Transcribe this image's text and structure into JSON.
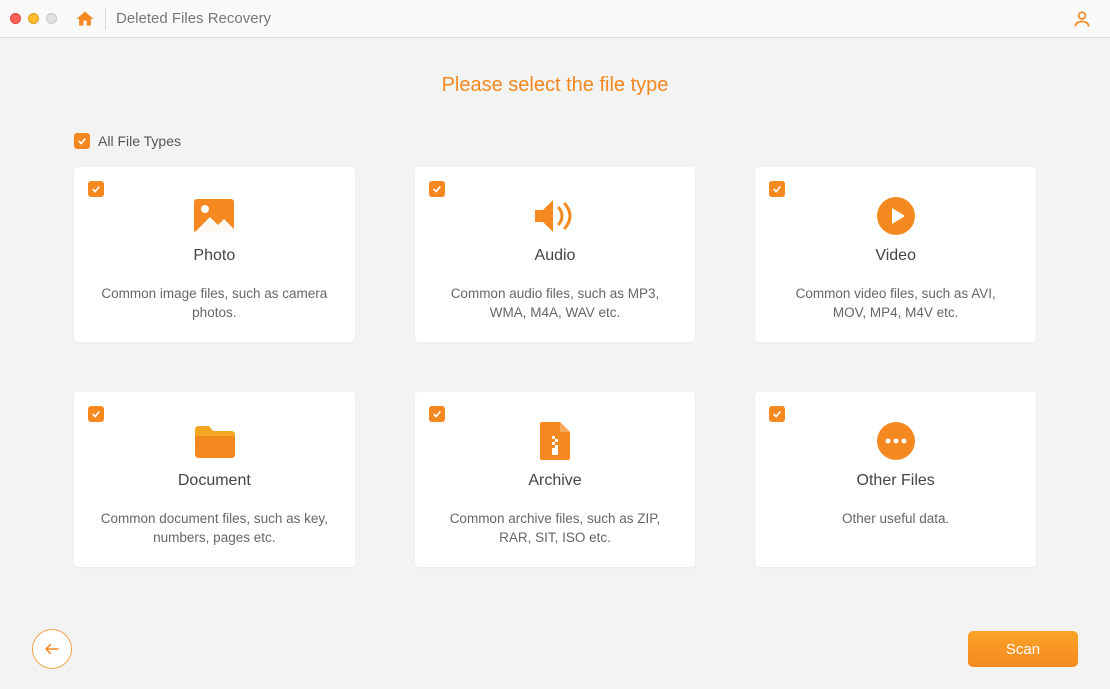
{
  "header": {
    "title": "Deleted Files Recovery"
  },
  "heading": "Please select the file type",
  "all_types_label": "All File Types",
  "cards": [
    {
      "title": "Photo",
      "desc": "Common image files, such as camera photos."
    },
    {
      "title": "Audio",
      "desc": "Common audio files, such as MP3, WMA, M4A, WAV etc."
    },
    {
      "title": "Video",
      "desc": "Common video files, such as AVI, MOV, MP4, M4V etc."
    },
    {
      "title": "Document",
      "desc": "Common document files, such as key, numbers, pages etc."
    },
    {
      "title": "Archive",
      "desc": "Common archive files, such as ZIP, RAR, SIT, ISO etc."
    },
    {
      "title": "Other Files",
      "desc": "Other useful data."
    }
  ],
  "footer": {
    "scan": "Scan"
  }
}
